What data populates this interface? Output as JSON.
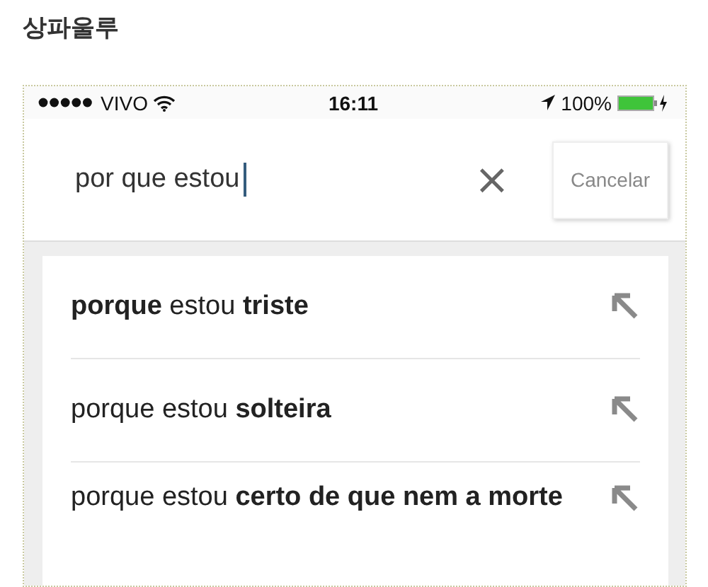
{
  "page_title": "상파울루",
  "status_bar": {
    "carrier": "VIVO",
    "time": "16:11",
    "battery": "100%"
  },
  "search": {
    "value": "por que estou",
    "clear": "×",
    "cancel": "Cancelar"
  },
  "suggestions": [
    {
      "text": "**porque** estou **triste**"
    },
    {
      "text": "porque estou **solteira**"
    },
    {
      "text": "porque estou **certo de que nem a morte**"
    }
  ]
}
